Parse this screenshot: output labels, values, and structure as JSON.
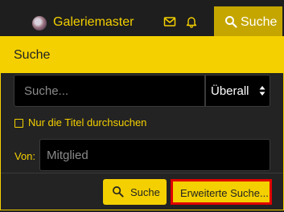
{
  "topbar": {
    "username": "Galeriemaster",
    "search_tab_label": "Suche",
    "icons": [
      "avatar",
      "mail-icon",
      "bell-icon",
      "search-icon"
    ]
  },
  "panel": {
    "title": "Suche",
    "search_placeholder": "Suche...",
    "scope_value": "Überall",
    "titles_only_label": "Nur die Titel durchsuchen",
    "titles_only_checked": false,
    "from_label": "Von:",
    "member_placeholder": "Mitglied",
    "search_button_label": "Suche",
    "advanced_button_label": "Erweiterte Suche..."
  },
  "colors": {
    "accent": "#f4d000",
    "accent_dark": "#c5a600",
    "background": "#232323",
    "input_bg": "#000000",
    "highlight": "#e00000"
  }
}
